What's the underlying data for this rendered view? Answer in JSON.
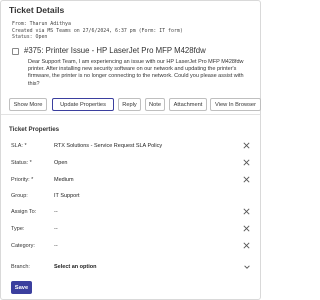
{
  "header": {
    "title": "Ticket Details"
  },
  "meta": {
    "from": "From: Tharun Adithya",
    "created": "Created via MS Teams on 27/6/2024, 6:37 pm (Form: IT form)",
    "status": "Status: Open"
  },
  "ticket": {
    "subject": "#375: Printer Issue - HP LaserJet Pro MFP M428fdw",
    "description": "Dear Support Team, I am experiencing an issue with our HP LaserJet Pro MFP M428fdw printer. After installing new security software on our network and updating the printer's firmware, the printer is no longer connecting to the network. Could you please assist with this?"
  },
  "actions": {
    "show_more": "Show More",
    "update_properties": "Update Properties",
    "reply": "Reply",
    "note": "Note",
    "attachment": "Attachment",
    "view_in_browser": "View In Browser"
  },
  "properties": {
    "title": "Ticket Properties",
    "sla": {
      "label": "SLA: *",
      "value": "RTX Solutions - Service Request SLA Policy"
    },
    "status": {
      "label": "Status: *",
      "value": "Open"
    },
    "priority": {
      "label": "Priority: *",
      "value": "Medium"
    },
    "group": {
      "label": "Group:",
      "value": "IT Support"
    },
    "assign_to": {
      "label": "Assign To:",
      "value": "--"
    },
    "type": {
      "label": "Type:",
      "value": "--"
    },
    "category": {
      "label": "Category:",
      "value": "--"
    },
    "branch": {
      "label": "Branch:",
      "value": "Select an option"
    }
  },
  "footer": {
    "save_label": "Save"
  },
  "colors": {
    "primary": "#3b3f9e",
    "border": "#d9d9d9"
  },
  "icons": {
    "clear": "close-icon",
    "dropdown": "chevron-down-icon",
    "checkbox": "checkbox-icon"
  }
}
